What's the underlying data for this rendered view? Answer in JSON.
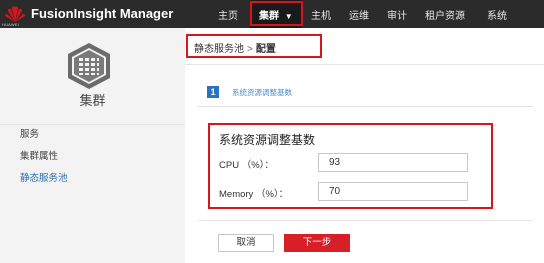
{
  "header": {
    "logo_caption": "HUAWEI",
    "app_title": "FusionInsight Manager",
    "nav": [
      {
        "label": "主页"
      },
      {
        "label": "集群",
        "active": true,
        "has_dropdown": true
      },
      {
        "label": "主机"
      },
      {
        "label": "运维"
      },
      {
        "label": "审计"
      },
      {
        "label": "租户资源"
      },
      {
        "label": "系统"
      }
    ],
    "dropdown_icon": "caret-down-icon"
  },
  "sidebar": {
    "icon": "cluster-icon",
    "title": "集群",
    "items": [
      {
        "label": "服务"
      },
      {
        "label": "集群属性"
      },
      {
        "label": "静态服务池",
        "selected": true
      }
    ]
  },
  "breadcrumb": {
    "parent": "静态服务池",
    "separator": ">",
    "current": "配置"
  },
  "step": {
    "number": "1",
    "label": "系统资源调整基数"
  },
  "panel": {
    "title": "系统资源调整基数",
    "fields": [
      {
        "label": "CPU （%）：",
        "value": "93"
      },
      {
        "label": "Memory （%）：",
        "value": "70"
      }
    ]
  },
  "actions": {
    "cancel_label": "取消",
    "next_label": "下一步"
  },
  "colors": {
    "topbar": "#2b2b2b",
    "highlight_frame": "#d9141d",
    "primary_button": "#d81e26",
    "step_badge": "#2a73c4",
    "link": "#2a6fb0"
  }
}
